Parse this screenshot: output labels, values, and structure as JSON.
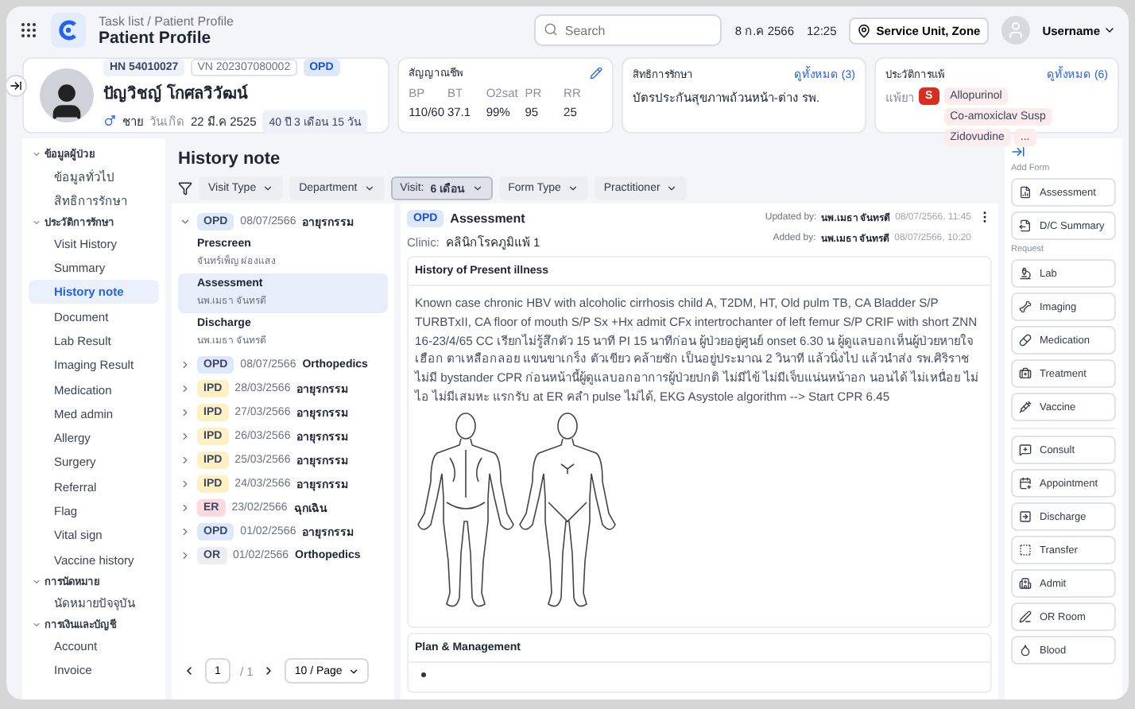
{
  "header": {
    "breadcrumb": "Task list / Patient Profile",
    "title": "Patient Profile",
    "search": {
      "placeholder": "Search"
    },
    "date": "8 ก.ค 2566",
    "time": "12:25",
    "unit": "Service Unit, Zone",
    "user": "Username"
  },
  "patient": {
    "hn": "HN 54010027",
    "vn": "VN 202307080002",
    "visit_type": "OPD",
    "name": "ปัญวิชญ์ โกศลวิวัฒน์",
    "sex": "ชาย",
    "birth_label": "วันเกิด",
    "birth_date": "22 มี.ค 2525",
    "age": "40 ปี 3 เดือน 15 วัน"
  },
  "vitals": {
    "title": "สัญญาณชีพ",
    "items": [
      {
        "label": "BP",
        "value": "110/60"
      },
      {
        "label": "BT",
        "value": "37.1"
      },
      {
        "label": "O2sat",
        "value": "99%"
      },
      {
        "label": "PR",
        "value": "95"
      },
      {
        "label": "RR",
        "value": "25"
      }
    ]
  },
  "coverage": {
    "title": "สิทธิการรักษา",
    "link": "ดูทั้งหมด (3)",
    "value": "บัตรประกันสุขภาพถ้วนหน้า-ต่าง รพ."
  },
  "allergy": {
    "title": "ประวัติการแพ้",
    "link": "ดูทั้งหมด (6)",
    "label": "แพ้ยา",
    "severity": "S",
    "tags": [
      "Allopurinol",
      "Co-amoxiclav Susp",
      "Zidovudine",
      "..."
    ]
  },
  "sidebar": [
    {
      "label": "ข้อมูลผู้ป่วย",
      "expanded": true,
      "children": [
        {
          "label": "ข้อมูลทั่วไป",
          "selected": false
        },
        {
          "label": "สิทธิการรักษา",
          "selected": false
        }
      ]
    },
    {
      "label": "ประวัติการรักษา",
      "expanded": true,
      "children": [
        {
          "label": "Visit History",
          "selected": false
        },
        {
          "label": "Summary",
          "selected": false
        },
        {
          "label": "History note",
          "selected": true
        },
        {
          "label": "Document",
          "selected": false
        },
        {
          "label": "Lab Result",
          "selected": false
        },
        {
          "label": "Imaging Result",
          "selected": false
        },
        {
          "label": "Medication",
          "selected": false
        },
        {
          "label": "Med admin",
          "selected": false
        },
        {
          "label": "Allergy",
          "selected": false
        },
        {
          "label": "Surgery",
          "selected": false
        },
        {
          "label": "Referral",
          "selected": false
        },
        {
          "label": "Flag",
          "selected": false
        },
        {
          "label": "Vital sign",
          "selected": false
        },
        {
          "label": "Vaccine history",
          "selected": false
        }
      ]
    },
    {
      "label": "การนัดหมาย",
      "expanded": true,
      "children": [
        {
          "label": "นัดหมายปัจจุบัน",
          "selected": false
        }
      ]
    },
    {
      "label": "การเงินและบัญชี",
      "expanded": true,
      "children": [
        {
          "label": "Account",
          "selected": false
        },
        {
          "label": "Invoice",
          "selected": false
        }
      ]
    }
  ],
  "page_title": "History note",
  "filters": [
    {
      "label": "Visit Type",
      "selected": false
    },
    {
      "label": "Department",
      "selected": false
    },
    {
      "label": "Visit:",
      "value": "6 เดือน",
      "selected": true
    },
    {
      "label": "Form Type",
      "selected": false
    },
    {
      "label": "Practitioner",
      "selected": false
    }
  ],
  "visits": [
    {
      "type": "OPD",
      "color": "#dde8fb",
      "date": "08/07/2566",
      "department": "อายุรกรรม",
      "expanded": true,
      "children": [
        {
          "title": "Prescreen",
          "author": "จันทร์เพ็ญ ผ่องแสง",
          "selected": false
        },
        {
          "title": "Assessment",
          "author": "นพ.เมธา จันทรดี",
          "selected": true
        },
        {
          "title": "Discharge",
          "author": "นพ.เมธา จันทรดี",
          "selected": false
        }
      ]
    },
    {
      "type": "OPD",
      "color": "#dde8fb",
      "date": "08/07/2566",
      "department": "Orthopedics",
      "expanded": false
    },
    {
      "type": "IPD",
      "color": "#fdf1c4",
      "date": "28/03/2566",
      "department": "อายุรกรรม",
      "expanded": false
    },
    {
      "type": "IPD",
      "color": "#fdf1c4",
      "date": "27/03/2566",
      "department": "อายุรกรรม",
      "expanded": false
    },
    {
      "type": "IPD",
      "color": "#fdf1c4",
      "date": "26/03/2566",
      "department": "อายุรกรรม",
      "expanded": false
    },
    {
      "type": "IPD",
      "color": "#fdf1c4",
      "date": "25/03/2566",
      "department": "อายุรกรรม",
      "expanded": false
    },
    {
      "type": "IPD",
      "color": "#fdf1c4",
      "date": "24/03/2566",
      "department": "อายุรกรรม",
      "expanded": false
    },
    {
      "type": "ER",
      "color": "#fbd9dc",
      "date": "23/02/2566",
      "department": "ฉุกเฉิน",
      "expanded": false
    },
    {
      "type": "OPD",
      "color": "#dde8fb",
      "date": "01/02/2566",
      "department": "อายุรกรรม",
      "expanded": false
    },
    {
      "type": "OR",
      "color": "#eceef2",
      "date": "01/02/2566",
      "department": "Orthopedics",
      "expanded": false
    }
  ],
  "pagination": {
    "page": "1",
    "total": "/ 1",
    "page_size": "10 / Page"
  },
  "note": {
    "type": "OPD",
    "title": "Assessment",
    "clinic_label": "Clinic:",
    "clinic": "คลินิกโรคภูมิแพ้ 1",
    "updated_label": "Updated by:",
    "updated_by": "นพ.เมธา จันทรดี",
    "updated_at": "08/07/2566, 11:45",
    "added_label": "Added by:",
    "added_by": "นพ.เมธา จันทรดี",
    "added_at": "08/07/2566, 10:20",
    "sections": [
      {
        "kind": "text_with_body_chart",
        "title": "History of Present illness",
        "body": "Known case chronic HBV with alcoholic cirrhosis child A, T2DM, HT, Old pulm TB, CA Bladder S/P TURBTxII, CA floor of mouth S/P Sx +Hx admit CFx intertrochanter of left femur S/P CRIF with short ZNN 16-23/4/65 CC เรียกไม่รู้สึกตัว 15 นาที PI 15 นาทีก่อน ผู้ป่วยอยู่ศูนย์ onset 6.30 น ผู้ดูแลบอกเห็นผู้ป่วยหายใจเฮือก ตาเหลือกลอย แขนขาเกร็ง ตัวเขียว คล้ายชัก เป็นอยู่ประมาณ 2 วินาที แล้วนิ่งไป แล้วนำส่ง รพ.ศิริราช ไม่มี bystander CPR ก่อนหน้านี้ผู้ดูแลบอกอาการผู้ป่วยปกติ ไม่มีไข้ ไม่มีเจ็บแน่นหน้าอก นอนได้ ไม่เหนื่อย ไม่ไอ ไม่มีเสมหะ แรกรับ at ER คลำ pulse ไม่ได้, EKG Asystole algorithm --> Start CPR 6.45"
      },
      {
        "kind": "bullet_list",
        "title": "Plan & Management"
      }
    ]
  },
  "actions": {
    "add_form_title": "Add Form",
    "add_form": [
      "Assessment",
      "D/C Summary"
    ],
    "request_title": "Request",
    "request": [
      "Lab",
      "Imaging",
      "Medication",
      "Treatment",
      "Vaccine"
    ],
    "other": [
      "Consult",
      "Appointment",
      "Discharge",
      "Transfer",
      "Admit",
      "OR Room",
      "Blood"
    ]
  }
}
